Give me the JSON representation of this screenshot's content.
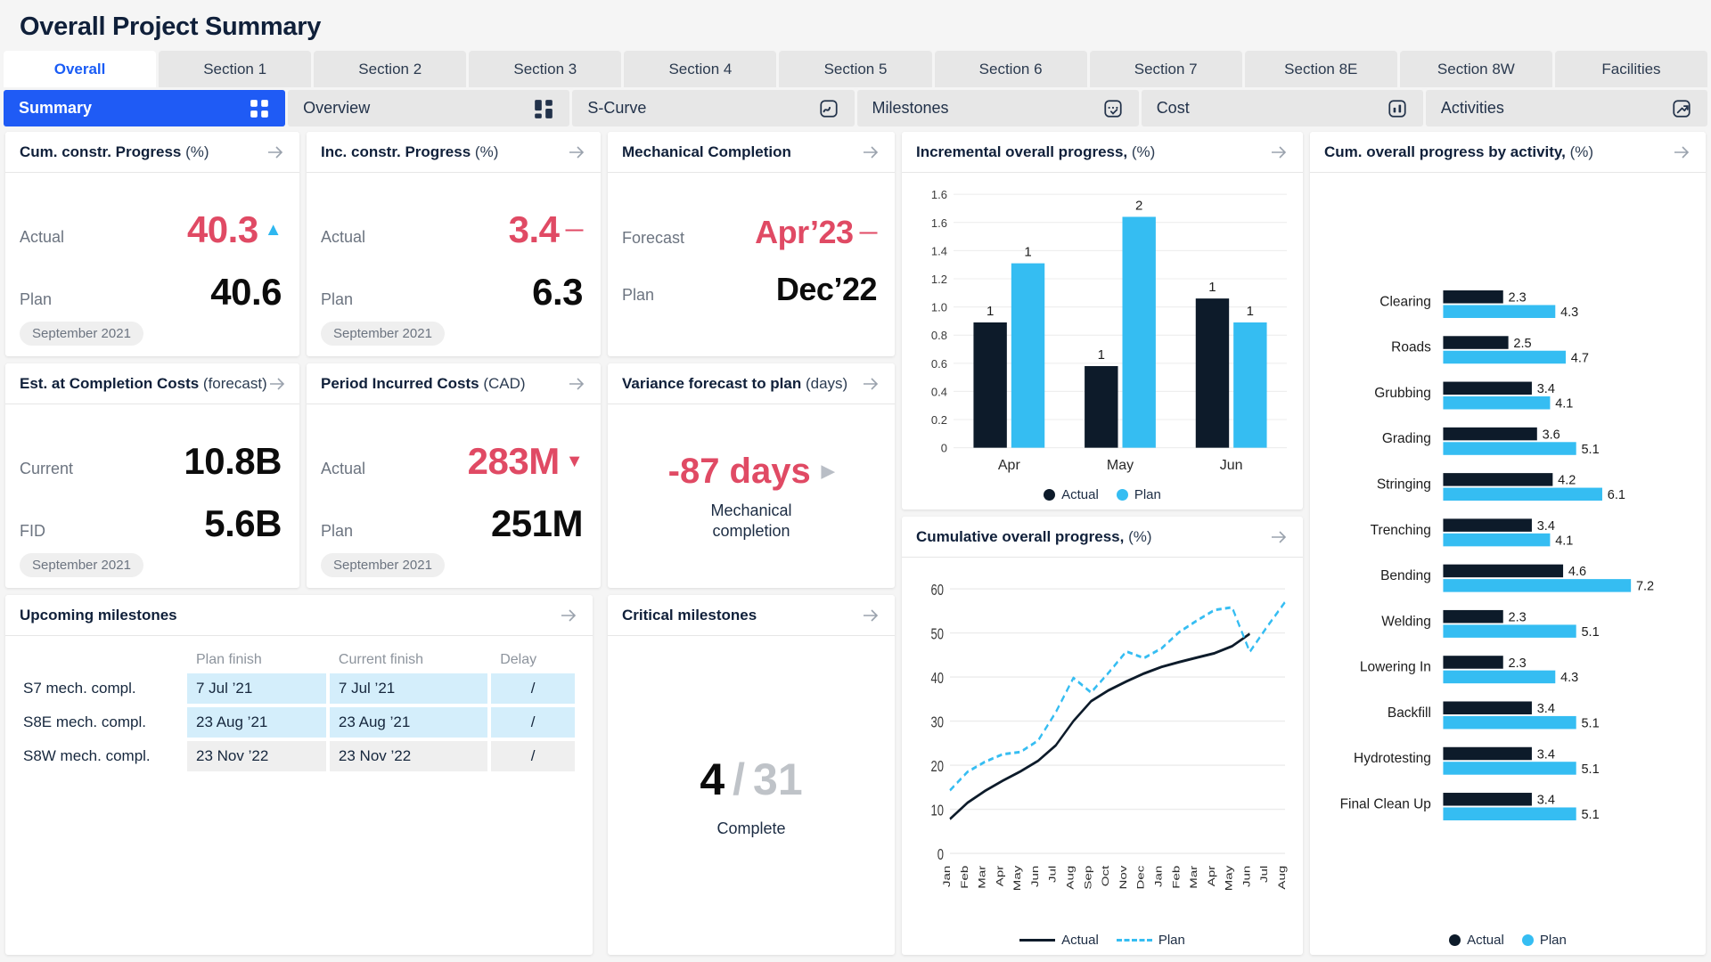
{
  "header": {
    "title": "Overall Project Summary"
  },
  "main_tabs": [
    {
      "label": "Overall",
      "active": true
    },
    {
      "label": "Section 1",
      "active": false
    },
    {
      "label": "Section 2",
      "active": false
    },
    {
      "label": "Section 3",
      "active": false
    },
    {
      "label": "Section 4",
      "active": false
    },
    {
      "label": "Section 5",
      "active": false
    },
    {
      "label": "Section 6",
      "active": false
    },
    {
      "label": "Section 7",
      "active": false
    },
    {
      "label": "Section 8E",
      "active": false
    },
    {
      "label": "Section 8W",
      "active": false
    },
    {
      "label": "Facilities",
      "active": false
    }
  ],
  "sub_tabs": [
    {
      "label": "Summary",
      "icon": "grid-four-icon",
      "active": true
    },
    {
      "label": "Overview",
      "icon": "dashboard-blocks-icon",
      "active": false
    },
    {
      "label": "S-Curve",
      "icon": "curve-chart-icon",
      "active": false
    },
    {
      "label": "Milestones",
      "icon": "milestone-check-icon",
      "active": false
    },
    {
      "label": "Cost",
      "icon": "bar-chart-icon",
      "active": false
    },
    {
      "label": "Activities",
      "icon": "trend-arrow-icon",
      "active": false
    }
  ],
  "cards": {
    "cum_constr_progress": {
      "title": "Cum. constr. Progress",
      "title_sub": "(%)",
      "rows": [
        {
          "label": "Actual",
          "value": "40.3",
          "style": "red",
          "trend": "up",
          "trend_glyph": "▲"
        },
        {
          "label": "Plan",
          "value": "40.6",
          "style": "black",
          "trend": "",
          "trend_glyph": ""
        }
      ],
      "chip": "September 2021"
    },
    "inc_constr_progress": {
      "title": "Inc. constr. Progress",
      "title_sub": "(%)",
      "rows": [
        {
          "label": "Actual",
          "value": "3.4",
          "style": "red",
          "trend": "flat",
          "trend_glyph": "—"
        },
        {
          "label": "Plan",
          "value": "6.3",
          "style": "black",
          "trend": "",
          "trend_glyph": ""
        }
      ],
      "chip": "September 2021"
    },
    "mechanical_completion": {
      "title": "Mechanical Completion",
      "title_sub": "",
      "rows": [
        {
          "label": "Forecast",
          "value": "Apr’23",
          "style": "red",
          "trend": "flat",
          "trend_glyph": "—"
        },
        {
          "label": "Plan",
          "value": "Dec’22",
          "style": "black",
          "trend": "",
          "trend_glyph": ""
        }
      ],
      "chip": ""
    },
    "est_completion_costs": {
      "title": "Est. at Completion Costs",
      "title_sub": "(forecast)",
      "rows": [
        {
          "label": "Current",
          "value": "10.8B",
          "style": "black",
          "trend": "",
          "trend_glyph": ""
        },
        {
          "label": "FID",
          "value": "5.6B",
          "style": "black",
          "trend": "",
          "trend_glyph": ""
        }
      ],
      "chip": "September 2021"
    },
    "period_incurred_costs": {
      "title": "Period Incurred Costs",
      "title_sub": "(CAD)",
      "rows": [
        {
          "label": "Actual",
          "value": "283M",
          "style": "red",
          "trend": "down",
          "trend_glyph": "▼"
        },
        {
          "label": "Plan",
          "value": "251M",
          "style": "black",
          "trend": "",
          "trend_glyph": ""
        }
      ],
      "chip": "September 2021"
    },
    "variance_forecast": {
      "title": "Variance forecast to plan",
      "title_sub": "(days)",
      "value": "-87 days",
      "caret_glyph": "▶",
      "subtitle_line1": "Mechanical",
      "subtitle_line2": "completion"
    },
    "critical_milestones": {
      "title": "Critical milestones",
      "completed": "4",
      "separator": "/",
      "total": "31",
      "caption": "Complete"
    },
    "upcoming_milestones": {
      "title": "Upcoming milestones",
      "columns": [
        "",
        "Plan finish",
        "Current finish",
        "Delay"
      ],
      "rows": [
        {
          "name": "S7 mech. compl.",
          "plan_finish": "7 Jul ’21",
          "current_finish": "7 Jul ’21",
          "delay": "/",
          "highlight": true
        },
        {
          "name": "S8E mech. compl.",
          "plan_finish": "23 Aug ’21",
          "current_finish": "23 Aug ’21",
          "delay": "/",
          "highlight": true
        },
        {
          "name": "S8W mech. compl.",
          "plan_finish": "23 Nov ’22",
          "current_finish": "23 Nov ’22",
          "delay": "/",
          "highlight": false
        }
      ]
    },
    "incremental_progress": {
      "title": "Incremental overall progress,",
      "title_sub": "(%)"
    },
    "cumulative_progress": {
      "title": "Cumulative overall progress,",
      "title_sub": "(%)"
    },
    "progress_by_activity": {
      "title": "Cum. overall progress by activity,",
      "title_sub": "(%)"
    }
  },
  "colors": {
    "accent_blue": "#1f5bf5",
    "actual_dark": "#0d1b2a",
    "plan_blue": "#35bdf2",
    "negative_red": "#e04a64",
    "tab_inactive": "#e7e7e7",
    "cell_highlight": "#d4eefb"
  },
  "chart_data": [
    {
      "id": "incremental_overall_progress",
      "type": "bar",
      "title": "Incremental overall progress, (%)",
      "categories": [
        "Apr",
        "May",
        "Jun"
      ],
      "series": [
        {
          "name": "Actual",
          "color": "#0d1b2a",
          "values": [
            0.89,
            0.58,
            1.06
          ],
          "labels": [
            "1",
            "1",
            "1"
          ]
        },
        {
          "name": "Plan",
          "color": "#35bdf2",
          "values": [
            1.31,
            1.64,
            0.89
          ],
          "labels": [
            "1",
            "2",
            "1"
          ]
        }
      ],
      "yticks": [
        "1.6",
        "1.6",
        "1.4",
        "1.2",
        "1.0",
        "0.8",
        "0.6",
        "0.4",
        "0.2",
        "0"
      ],
      "ytick_values": [
        1.8,
        1.6,
        1.4,
        1.2,
        1.0,
        0.8,
        0.6,
        0.4,
        0.2,
        0
      ],
      "ylim": [
        0,
        1.8
      ],
      "grid": true,
      "legend": [
        "Actual",
        "Plan"
      ],
      "legend_position": "bottom"
    },
    {
      "id": "cumulative_overall_progress",
      "type": "line",
      "title": "Cumulative overall progress, (%)",
      "x": [
        "Jan",
        "Feb",
        "Mar",
        "Apr",
        "May",
        "Jun",
        "Jul",
        "Aug",
        "Sep",
        "Oct",
        "Nov",
        "Dec",
        "Jan",
        "Feb",
        "Mar",
        "Apr",
        "May",
        "Jun",
        "Jul",
        "Aug"
      ],
      "series": [
        {
          "name": "Actual",
          "color": "#0d1b2a",
          "style": "solid",
          "values": [
            7.8,
            11.5,
            14.2,
            16.5,
            18.6,
            21.0,
            24.5,
            30.0,
            34.5,
            37.0,
            39.0,
            40.8,
            42.3,
            43.4,
            44.4,
            45.4,
            47.0,
            49.8,
            null,
            null
          ]
        },
        {
          "name": "Plan",
          "color": "#35bdf2",
          "style": "dashed",
          "values": [
            14.3,
            18.5,
            20.8,
            22.5,
            23.0,
            25.6,
            32.0,
            39.8,
            36.5,
            41.0,
            45.8,
            44.3,
            46.5,
            50.2,
            52.8,
            55.2,
            55.8,
            45.7,
            51.5,
            57.0
          ]
        }
      ],
      "yticks": [
        "0",
        "10",
        "20",
        "30",
        "40",
        "50",
        "60"
      ],
      "ylim": [
        0,
        62
      ],
      "grid": true,
      "legend": [
        "Actual",
        "Plan"
      ],
      "legend_position": "bottom"
    },
    {
      "id": "cum_overall_progress_by_activity",
      "type": "bar",
      "orientation": "horizontal",
      "title": "Cum. overall progress by activity, (%)",
      "categories": [
        "Clearing",
        "Roads",
        "Grubbing",
        "Grading",
        "Stringing",
        "Trenching",
        "Bending",
        "Welding",
        "Lowering In",
        "Backfill",
        "Hydrotesting",
        "Final Clean Up"
      ],
      "series": [
        {
          "name": "Actual",
          "color": "#0d1b2a",
          "values": [
            2.3,
            2.5,
            3.4,
            3.6,
            4.2,
            3.4,
            4.6,
            2.3,
            2.3,
            3.4,
            3.4,
            3.4
          ]
        },
        {
          "name": "Plan",
          "color": "#35bdf2",
          "values": [
            4.3,
            4.7,
            4.1,
            5.1,
            6.1,
            4.1,
            7.2,
            5.1,
            4.3,
            5.1,
            5.1,
            5.1
          ]
        }
      ],
      "xmax": 8.0,
      "grid": false,
      "legend": [
        "Actual",
        "Plan"
      ],
      "legend_position": "bottom"
    }
  ]
}
